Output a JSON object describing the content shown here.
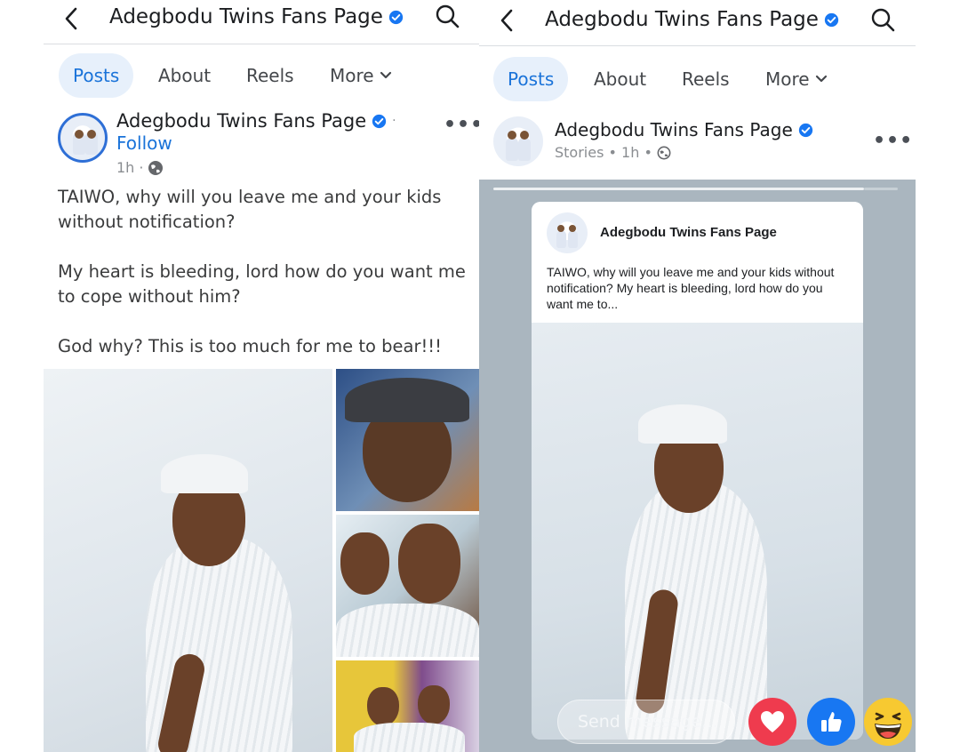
{
  "left": {
    "header": {
      "title": "Adegbodu Twins Fans Page"
    },
    "tabs": [
      {
        "label": "Posts"
      },
      {
        "label": "About"
      },
      {
        "label": "Reels"
      },
      {
        "label": "More"
      }
    ],
    "post": {
      "author": "Adegbodu Twins Fans Page",
      "separator": "·",
      "follow": "Follow",
      "time": "1h",
      "meta_sep": "·",
      "paragraphs": [
        "TAIWO, why will you leave me and your kids without notification?",
        "My heart is bleeding, lord how do you want me to cope without him?",
        "God why? This is too much for me to bear!!!"
      ]
    }
  },
  "right": {
    "header": {
      "title": "Adegbodu Twins Fans Page"
    },
    "tabs": [
      {
        "label": "Posts"
      },
      {
        "label": "About"
      },
      {
        "label": "Reels"
      },
      {
        "label": "More"
      }
    ],
    "post": {
      "author": "Adegbodu Twins Fans Page",
      "meta": "Stories • 1h •"
    },
    "story": {
      "card_author": "Adegbodu Twins Fans Page",
      "card_text": "TAIWO, why will you leave me and your kids without notification? My heart is bleeding, lord how do you want me to...",
      "send_placeholder": "Send message..."
    }
  },
  "colors": {
    "accent": "#1a73d9",
    "verified": "#1877f2",
    "tab_active_bg": "#e7f0fb",
    "heart": "#ef3b4e",
    "like": "#1877f2",
    "haha": "#f7c931"
  },
  "icons": [
    "back-arrow-icon",
    "verified-badge-icon",
    "search-icon",
    "chevron-down-icon",
    "more-dots-icon",
    "globe-icon",
    "heart-reaction-icon",
    "like-reaction-icon",
    "haha-reaction-icon"
  ]
}
